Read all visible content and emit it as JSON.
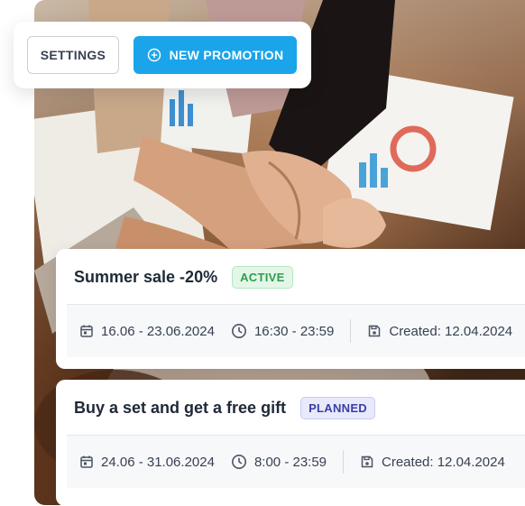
{
  "toolbar": {
    "settings_label": "SETTINGS",
    "new_promotion_label": "NEW PROMOTION"
  },
  "promotions": [
    {
      "title": "Summer sale -20%",
      "status": "ACTIVE",
      "dates": "16.06 - 23.06.2024",
      "time": "16:30 - 23:59",
      "created": "Created: 12.04.2024"
    },
    {
      "title": "Buy a set and get a free gift",
      "status": "PLANNED",
      "dates": "24.06 - 31.06.2024",
      "time": "8:00 - 23:59",
      "created": "Created: 12.04.2024"
    }
  ],
  "colors": {
    "primary": "#1ba4ea",
    "active_badge": "#2e9e4f",
    "planned_badge": "#3a3fa5"
  },
  "icons": {
    "new_promotion": "plus-circle-icon",
    "dates": "calendar-icon",
    "time": "clock-icon",
    "created": "save-icon"
  }
}
